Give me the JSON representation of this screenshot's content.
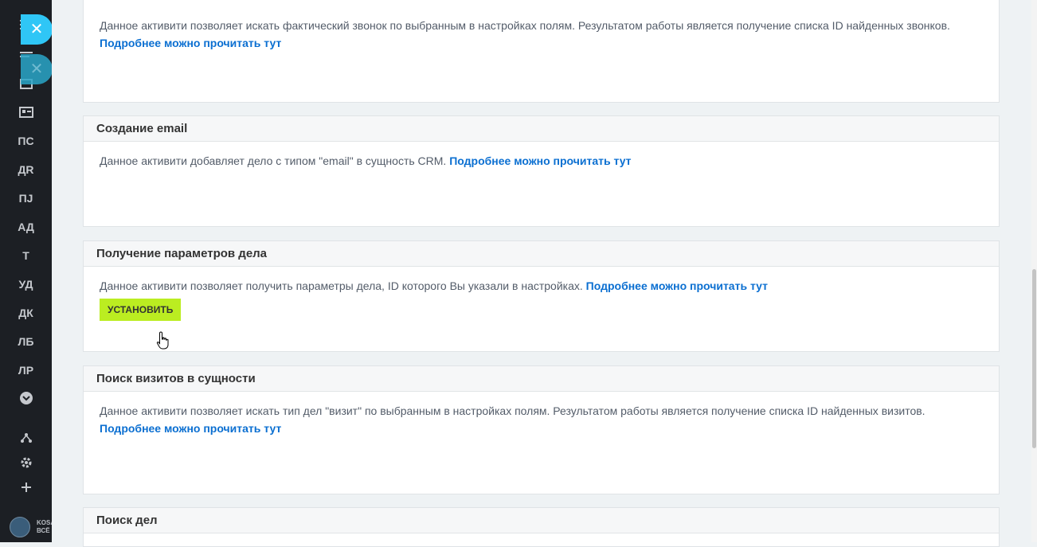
{
  "sidebar": {
    "items": [
      {
        "label": "ПС"
      },
      {
        "label": "ДR"
      },
      {
        "label": "ПJ"
      },
      {
        "label": "АД"
      },
      {
        "label": "Т"
      },
      {
        "label": "УД"
      },
      {
        "label": "ДК"
      },
      {
        "label": "ЛБ"
      },
      {
        "label": "ЛР"
      }
    ],
    "logo_text_line1": "KOSA",
    "logo_text_line2": "ВСЁ Б"
  },
  "cards": [
    {
      "title": "",
      "description": "Данное активити позволяет искать фактический звонок по выбранным в настройках полям. Результатом работы является получение списка ID найденных звонков.",
      "link": "Подробнее можно прочитать тут"
    },
    {
      "title": "Создание email",
      "description": "Данное активити добавляет дело с типом \"email\" в сущность CRM.",
      "link": "Подробнее можно прочитать тут"
    },
    {
      "title": "Получение параметров дела",
      "description": "Данное активити позволяет получить параметры дела, ID которого Вы указали в настройках.",
      "link": "Подробнее можно прочитать тут",
      "button": "УСТАНОВИТЬ"
    },
    {
      "title": "Поиск визитов в сущности",
      "description": "Данное активити позволяет искать тип дел \"визит\" по выбранным в настройках полям. Результатом работы является получение списка ID найденных визитов.",
      "link": "Подробнее можно прочитать тут"
    },
    {
      "title": "Поиск дел"
    }
  ],
  "colors": {
    "accent_button": "#bbed21",
    "link": "#0b6fd1",
    "close_button": "#2fc6f6",
    "sidebar_bg": "#1c1f24"
  }
}
